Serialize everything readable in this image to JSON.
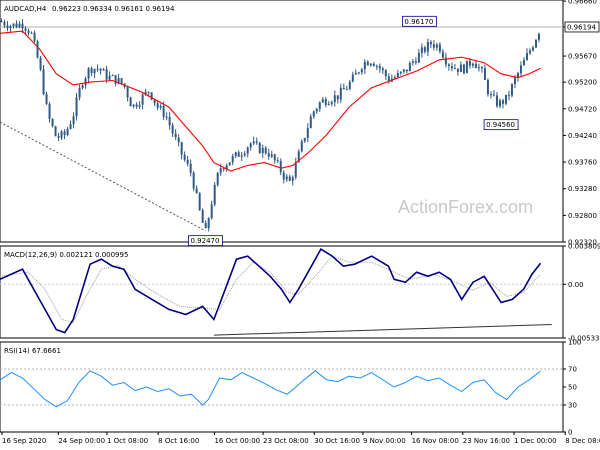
{
  "chart_data": [
    {
      "type": "candlestick",
      "panel": "price",
      "header": {
        "symbol": "AUDCAD,H4",
        "ohlc": "0.96223 0.96334 0.96161 0.96194"
      },
      "watermark": "ActionForex.com",
      "ylim": [
        0.9232,
        0.9668
      ],
      "y_ticks": [
        "0.96660",
        "0.96194",
        "0.95670",
        "0.95200",
        "0.94720",
        "0.94240",
        "0.93760",
        "0.93280",
        "0.92800",
        "0.92320"
      ],
      "last_price": 0.96194,
      "last_price_label": "0.96194",
      "annotations": [
        {
          "label": "0.96170",
          "value": 0.9617,
          "at": 0.745
        },
        {
          "label": "0.94560",
          "value": 0.9456,
          "at": 0.89
        },
        {
          "label": "0.92470",
          "value": 0.9247,
          "at": 0.365
        }
      ],
      "moving_average_color": "#ff0000",
      "candle_color": "#2f5a86",
      "close_path": [
        [
          0.0,
          0.963
        ],
        [
          0.02,
          0.9622
        ],
        [
          0.04,
          0.9625
        ],
        [
          0.055,
          0.961
        ],
        [
          0.07,
          0.955
        ],
        [
          0.085,
          0.946
        ],
        [
          0.1,
          0.942
        ],
        [
          0.115,
          0.9425
        ],
        [
          0.13,
          0.946
        ],
        [
          0.145,
          0.952
        ],
        [
          0.16,
          0.9545
        ],
        [
          0.175,
          0.9545
        ],
        [
          0.19,
          0.953
        ],
        [
          0.205,
          0.9525
        ],
        [
          0.22,
          0.9515
        ],
        [
          0.235,
          0.9475
        ],
        [
          0.25,
          0.949
        ],
        [
          0.265,
          0.9505
        ],
        [
          0.28,
          0.9475
        ],
        [
          0.295,
          0.946
        ],
        [
          0.31,
          0.942
        ],
        [
          0.325,
          0.9385
        ],
        [
          0.34,
          0.9355
        ],
        [
          0.355,
          0.9285
        ],
        [
          0.365,
          0.9247
        ],
        [
          0.375,
          0.93
        ],
        [
          0.39,
          0.9365
        ],
        [
          0.41,
          0.938
        ],
        [
          0.43,
          0.9395
        ],
        [
          0.445,
          0.941
        ],
        [
          0.46,
          0.94
        ],
        [
          0.475,
          0.9395
        ],
        [
          0.49,
          0.9375
        ],
        [
          0.505,
          0.935
        ],
        [
          0.515,
          0.934
        ],
        [
          0.525,
          0.937
        ],
        [
          0.54,
          0.942
        ],
        [
          0.555,
          0.9465
        ],
        [
          0.57,
          0.9485
        ],
        [
          0.585,
          0.949
        ],
        [
          0.6,
          0.9495
        ],
        [
          0.615,
          0.951
        ],
        [
          0.63,
          0.953
        ],
        [
          0.645,
          0.9555
        ],
        [
          0.66,
          0.956
        ],
        [
          0.675,
          0.9545
        ],
        [
          0.69,
          0.9525
        ],
        [
          0.705,
          0.953
        ],
        [
          0.72,
          0.954
        ],
        [
          0.735,
          0.956
        ],
        [
          0.75,
          0.9575
        ],
        [
          0.765,
          0.959
        ],
        [
          0.78,
          0.9585
        ],
        [
          0.795,
          0.9555
        ],
        [
          0.81,
          0.9545
        ],
        [
          0.825,
          0.9545
        ],
        [
          0.84,
          0.956
        ],
        [
          0.855,
          0.954
        ],
        [
          0.87,
          0.9495
        ],
        [
          0.885,
          0.948
        ],
        [
          0.9,
          0.949
        ],
        [
          0.915,
          0.9525
        ],
        [
          0.93,
          0.9555
        ],
        [
          0.945,
          0.9585
        ],
        [
          0.96,
          0.9619
        ]
      ],
      "moving_average_path": [
        [
          0.0,
          0.9608
        ],
        [
          0.04,
          0.9612
        ],
        [
          0.07,
          0.958
        ],
        [
          0.1,
          0.9535
        ],
        [
          0.13,
          0.9515
        ],
        [
          0.16,
          0.952
        ],
        [
          0.2,
          0.9523
        ],
        [
          0.25,
          0.9503
        ],
        [
          0.3,
          0.9475
        ],
        [
          0.33,
          0.944
        ],
        [
          0.36,
          0.9405
        ],
        [
          0.38,
          0.9375
        ],
        [
          0.41,
          0.936
        ],
        [
          0.44,
          0.937
        ],
        [
          0.47,
          0.9375
        ],
        [
          0.5,
          0.9365
        ],
        [
          0.52,
          0.937
        ],
        [
          0.55,
          0.9395
        ],
        [
          0.58,
          0.9425
        ],
        [
          0.62,
          0.9475
        ],
        [
          0.66,
          0.951
        ],
        [
          0.7,
          0.9525
        ],
        [
          0.74,
          0.954
        ],
        [
          0.78,
          0.956
        ],
        [
          0.82,
          0.9565
        ],
        [
          0.86,
          0.9555
        ],
        [
          0.89,
          0.9535
        ],
        [
          0.92,
          0.9528
        ],
        [
          0.94,
          0.9535
        ],
        [
          0.96,
          0.9545
        ]
      ],
      "trendlines": [
        {
          "from": [
            0.0,
            0.9448
          ],
          "to": [
            0.365,
            0.9252
          ],
          "style": "dashed"
        }
      ]
    },
    {
      "type": "line",
      "panel": "indicator",
      "header": "MACD(12,26,9) 0.002121 0.000995",
      "ylim": [
        -0.005339,
        0.003809
      ],
      "y_ticks": [
        "0.003809",
        "0.00",
        "-0.005339"
      ],
      "zero_label": "0.00",
      "series": [
        {
          "color": "#000080",
          "style": "main",
          "values": [
            [
              0.0,
              0.0005
            ],
            [
              0.04,
              0.0015
            ],
            [
              0.07,
              -0.0015
            ],
            [
              0.1,
              -0.0045
            ],
            [
              0.115,
              -0.0048
            ],
            [
              0.13,
              -0.0035
            ],
            [
              0.16,
              0.002
            ],
            [
              0.18,
              0.0025
            ],
            [
              0.2,
              0.0018
            ],
            [
              0.22,
              0.0015
            ],
            [
              0.24,
              -0.0005
            ],
            [
              0.27,
              -0.0015
            ],
            [
              0.3,
              -0.0025
            ],
            [
              0.33,
              -0.003
            ],
            [
              0.36,
              -0.0022
            ],
            [
              0.38,
              -0.0035
            ],
            [
              0.4,
              -0.0005
            ],
            [
              0.42,
              0.0025
            ],
            [
              0.44,
              0.0028
            ],
            [
              0.46,
              0.0018
            ],
            [
              0.48,
              0.0008
            ],
            [
              0.5,
              -0.0005
            ],
            [
              0.515,
              -0.0018
            ],
            [
              0.53,
              -0.0005
            ],
            [
              0.55,
              0.0015
            ],
            [
              0.57,
              0.0035
            ],
            [
              0.59,
              0.0028
            ],
            [
              0.61,
              0.0018
            ],
            [
              0.63,
              0.002
            ],
            [
              0.66,
              0.0028
            ],
            [
              0.69,
              0.0018
            ],
            [
              0.7,
              0.0005
            ],
            [
              0.72,
              0.0002
            ],
            [
              0.74,
              0.0012
            ],
            [
              0.76,
              0.0008
            ],
            [
              0.78,
              0.0012
            ],
            [
              0.8,
              0.0005
            ],
            [
              0.82,
              -0.0015
            ],
            [
              0.84,
              0.0002
            ],
            [
              0.86,
              0.0008
            ],
            [
              0.875,
              -0.0005
            ],
            [
              0.89,
              -0.0018
            ],
            [
              0.91,
              -0.0015
            ],
            [
              0.93,
              -0.0005
            ],
            [
              0.945,
              0.001
            ],
            [
              0.96,
              0.0021
            ]
          ]
        },
        {
          "color": "#a0a0a0",
          "style": "signal",
          "values": [
            [
              0.0,
              0.0008
            ],
            [
              0.05,
              0.0012
            ],
            [
              0.08,
              -0.0005
            ],
            [
              0.11,
              -0.0035
            ],
            [
              0.13,
              -0.0038
            ],
            [
              0.15,
              -0.0015
            ],
            [
              0.18,
              0.0015
            ],
            [
              0.21,
              0.0019
            ],
            [
              0.24,
              0.0005
            ],
            [
              0.28,
              -0.001
            ],
            [
              0.32,
              -0.0022
            ],
            [
              0.36,
              -0.0024
            ],
            [
              0.39,
              -0.0025
            ],
            [
              0.42,
              0.0005
            ],
            [
              0.45,
              0.0022
            ],
            [
              0.48,
              0.0012
            ],
            [
              0.51,
              -0.0008
            ],
            [
              0.53,
              -0.001
            ],
            [
              0.56,
              0.0008
            ],
            [
              0.59,
              0.0028
            ],
            [
              0.62,
              0.0022
            ],
            [
              0.66,
              0.0022
            ],
            [
              0.7,
              0.0012
            ],
            [
              0.73,
              0.0005
            ],
            [
              0.77,
              0.001
            ],
            [
              0.81,
              0.0002
            ],
            [
              0.84,
              -0.0006
            ],
            [
              0.87,
              0.0002
            ],
            [
              0.9,
              -0.0012
            ],
            [
              0.93,
              -0.0008
            ],
            [
              0.96,
              0.001
            ]
          ]
        }
      ],
      "trendlines": [
        {
          "from": [
            0.38,
            -0.00505
          ],
          "to": [
            0.98,
            -0.004
          ],
          "style": "solid"
        }
      ]
    },
    {
      "type": "line",
      "panel": "indicator",
      "header": "RSI(14) 67.6661",
      "ylim": [
        0,
        100
      ],
      "y_ticks": [
        "100",
        "70",
        "50",
        "30",
        "0"
      ],
      "levels": [
        70,
        30
      ],
      "series": [
        {
          "color": "#1e90ff",
          "values": [
            [
              0.0,
              58
            ],
            [
              0.02,
              66
            ],
            [
              0.04,
              60
            ],
            [
              0.06,
              48
            ],
            [
              0.08,
              36
            ],
            [
              0.1,
              28
            ],
            [
              0.12,
              35
            ],
            [
              0.14,
              55
            ],
            [
              0.16,
              68
            ],
            [
              0.18,
              62
            ],
            [
              0.2,
              52
            ],
            [
              0.22,
              55
            ],
            [
              0.24,
              46
            ],
            [
              0.26,
              50
            ],
            [
              0.28,
              45
            ],
            [
              0.3,
              48
            ],
            [
              0.32,
              40
            ],
            [
              0.34,
              42
            ],
            [
              0.36,
              30
            ],
            [
              0.37,
              36
            ],
            [
              0.39,
              60
            ],
            [
              0.41,
              58
            ],
            [
              0.43,
              66
            ],
            [
              0.45,
              60
            ],
            [
              0.47,
              54
            ],
            [
              0.49,
              47
            ],
            [
              0.51,
              42
            ],
            [
              0.52,
              47
            ],
            [
              0.54,
              58
            ],
            [
              0.56,
              68
            ],
            [
              0.58,
              58
            ],
            [
              0.6,
              56
            ],
            [
              0.62,
              62
            ],
            [
              0.64,
              60
            ],
            [
              0.66,
              66
            ],
            [
              0.68,
              58
            ],
            [
              0.7,
              50
            ],
            [
              0.72,
              55
            ],
            [
              0.74,
              62
            ],
            [
              0.76,
              57
            ],
            [
              0.78,
              60
            ],
            [
              0.8,
              52
            ],
            [
              0.82,
              45
            ],
            [
              0.84,
              55
            ],
            [
              0.86,
              58
            ],
            [
              0.88,
              44
            ],
            [
              0.9,
              36
            ],
            [
              0.92,
              50
            ],
            [
              0.94,
              58
            ],
            [
              0.96,
              67.7
            ]
          ]
        }
      ]
    }
  ],
  "x_axis_labels": [
    {
      "label": "16 Sep 2020",
      "at": 0.0
    },
    {
      "label": "24 Sep 00:00",
      "at": 0.11
    },
    {
      "label": "1 Oct 08:00",
      "at": 0.205
    },
    {
      "label": "8 Oct 16:00",
      "at": 0.305
    },
    {
      "label": "16 Oct 00:00",
      "at": 0.415
    },
    {
      "label": "23 Oct 08:00",
      "at": 0.51
    },
    {
      "label": "30 Oct 16:00",
      "at": 0.61
    },
    {
      "label": "9 Nov 00:00",
      "at": 0.705
    },
    {
      "label": "16 Nov 08:00",
      "at": 0.8
    },
    {
      "label": "23 Nov 16:00",
      "at": 0.9
    },
    {
      "label": "1 Dec 00:00",
      "at": 1.0
    },
    {
      "label": "8 Dec 08:00",
      "at": 1.1
    }
  ]
}
